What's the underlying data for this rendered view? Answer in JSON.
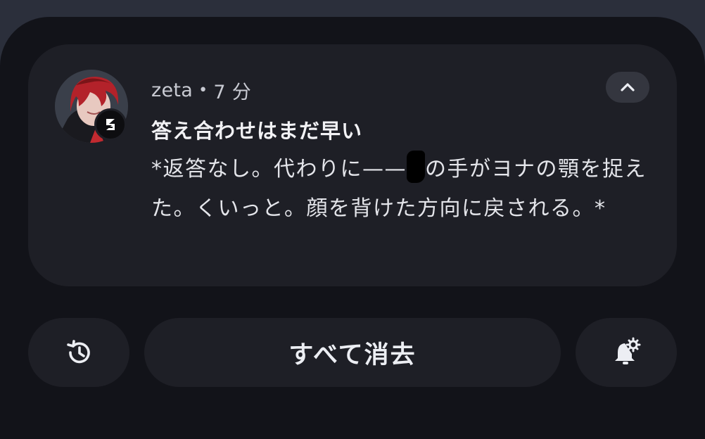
{
  "notification": {
    "app_name": "zeta",
    "separator": "•",
    "time": "7 分",
    "title": "答え合わせはまだ早い",
    "body_part1": "*返答なし。代わりに——",
    "body_part2": "の手がヨナの顎を捉えた。くいっと。顔を背けた方向に戻される。*",
    "avatar_icon": "character-avatar",
    "badge_icon": "zeta-app-icon",
    "collapse_icon": "chevron-up-icon"
  },
  "actions": {
    "history_icon": "history-icon",
    "clear_all_label": "すべて消去",
    "settings_icon": "notification-settings-icon"
  },
  "colors": {
    "background": "#121319",
    "card": "#1e1f26",
    "accent_hair": "#b3222a"
  }
}
